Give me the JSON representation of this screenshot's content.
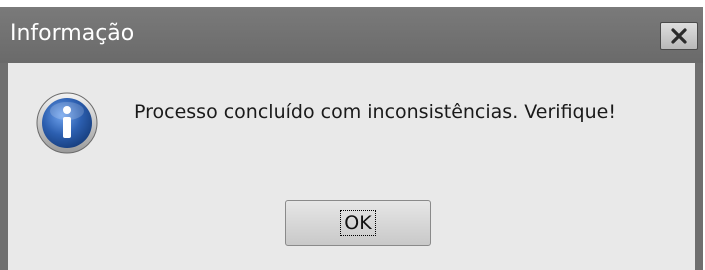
{
  "window": {
    "title": "Informação",
    "close_icon": "close-icon"
  },
  "body": {
    "icon": "info-icon",
    "message": "Processo concluído com inconsistências. Verifique!"
  },
  "buttons": {
    "ok_label": "OK"
  },
  "colors": {
    "titlebar": "#6f6f6f",
    "content_bg": "#e9e9e9",
    "icon_blue": "#2c5fb0"
  }
}
